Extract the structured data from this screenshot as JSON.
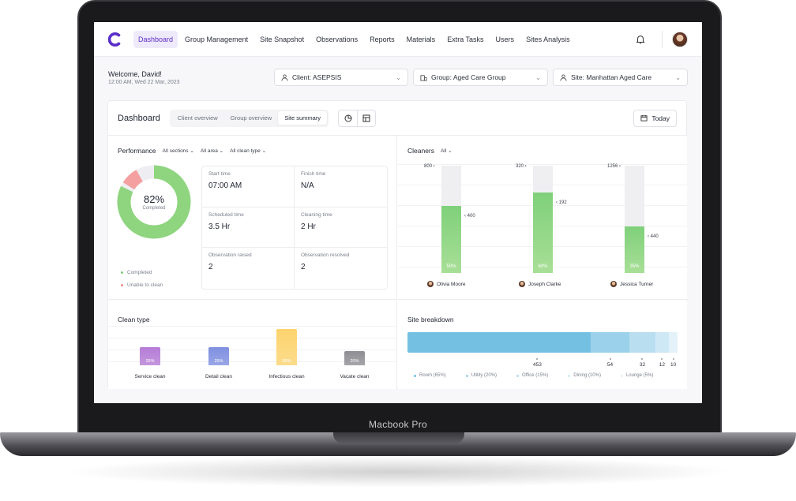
{
  "device": {
    "label": "Macbook Pro"
  },
  "nav": {
    "items": [
      {
        "label": "Dashboard",
        "active": true
      },
      {
        "label": "Group Management"
      },
      {
        "label": "Site Snapshot"
      },
      {
        "label": "Observations"
      },
      {
        "label": "Reports"
      },
      {
        "label": "Materials"
      },
      {
        "label": "Extra Tasks"
      },
      {
        "label": "Users"
      },
      {
        "label": "Sites Analysis"
      }
    ],
    "icons": {
      "logo": "brand-c-logo",
      "bell": "bell-icon",
      "avatar": "user-avatar"
    }
  },
  "header": {
    "welcome": "Welcome, David!",
    "datetime": "12:00 AM, Wed 22 Mar, 2023",
    "filters": [
      {
        "label": "Client: ASEPSIS",
        "icon": "user-icon"
      },
      {
        "label": "Group: Aged Care Group",
        "icon": "building-icon"
      },
      {
        "label": "Site: Manhattan Aged Care",
        "icon": "users-icon"
      }
    ]
  },
  "dashboard": {
    "title": "Dashboard",
    "tabs": [
      {
        "label": "Client overview"
      },
      {
        "label": "Group overview"
      },
      {
        "label": "Site summary",
        "active": true
      }
    ],
    "today_label": "Today"
  },
  "performance": {
    "title": "Performance",
    "dropdowns": [
      "All sections",
      "All area",
      "All clean type"
    ],
    "completed_pct": 82,
    "percent_label": "82%",
    "center_label": "Completed",
    "legend": [
      {
        "label": "Completed",
        "color": "#7fd07a"
      },
      {
        "label": "Unable to clean",
        "color": "#f08a8a"
      }
    ],
    "stats": [
      {
        "label": "Start time",
        "value": "07:00 AM"
      },
      {
        "label": "Finish time",
        "value": "N/A"
      },
      {
        "label": "Scheduled time",
        "value": "3.5 Hr"
      },
      {
        "label": "Cleaning time",
        "value": "2 Hr"
      },
      {
        "label": "Observation raised",
        "value": "2"
      },
      {
        "label": "Observation resolved",
        "value": "2"
      }
    ]
  },
  "cleaners": {
    "title": "Cleaners",
    "filter": "All",
    "items": [
      {
        "name": "Olivia Moore",
        "max": "800",
        "value": "400",
        "pct": 50,
        "pct_label": "50%"
      },
      {
        "name": "Joseph Clarke",
        "max": "320",
        "value": "192",
        "pct": 60,
        "pct_label": "60%"
      },
      {
        "name": "Jessica Turner",
        "max": "1256",
        "value": "440",
        "pct": 35,
        "pct_label": "35%"
      }
    ]
  },
  "clean_type": {
    "title": "Clean type",
    "items": [
      {
        "label": "Service clean",
        "pct": 25,
        "pct_label": "25%",
        "color": "#b57cd6"
      },
      {
        "label": "Detail clean",
        "pct": 25,
        "pct_label": "25%",
        "color": "#7f90e0"
      },
      {
        "label": "Infectious clean",
        "pct": 50,
        "pct_label": "50%",
        "color": "#fcd36e"
      },
      {
        "label": "Vacate clean",
        "pct": 20,
        "pct_label": "20%",
        "color": "#8e8e94"
      }
    ]
  },
  "site_breakdown": {
    "title": "Site breakdown",
    "segments": [
      {
        "label": "Room (65%)",
        "value": "453",
        "pct": 65,
        "color": "#74c0e3"
      },
      {
        "label": "Utility (20%)",
        "value": "54",
        "pct": 14,
        "color": "#9bd1ea"
      },
      {
        "label": "Office (15%)",
        "value": "32",
        "pct": 9,
        "color": "#b8def0"
      },
      {
        "label": "Dining (10%)",
        "value": "12",
        "pct": 5,
        "color": "#cfe8f5"
      },
      {
        "label": "Lounge (5%)",
        "value": "10",
        "pct": 3,
        "color": "#e3f1f8"
      }
    ]
  }
}
